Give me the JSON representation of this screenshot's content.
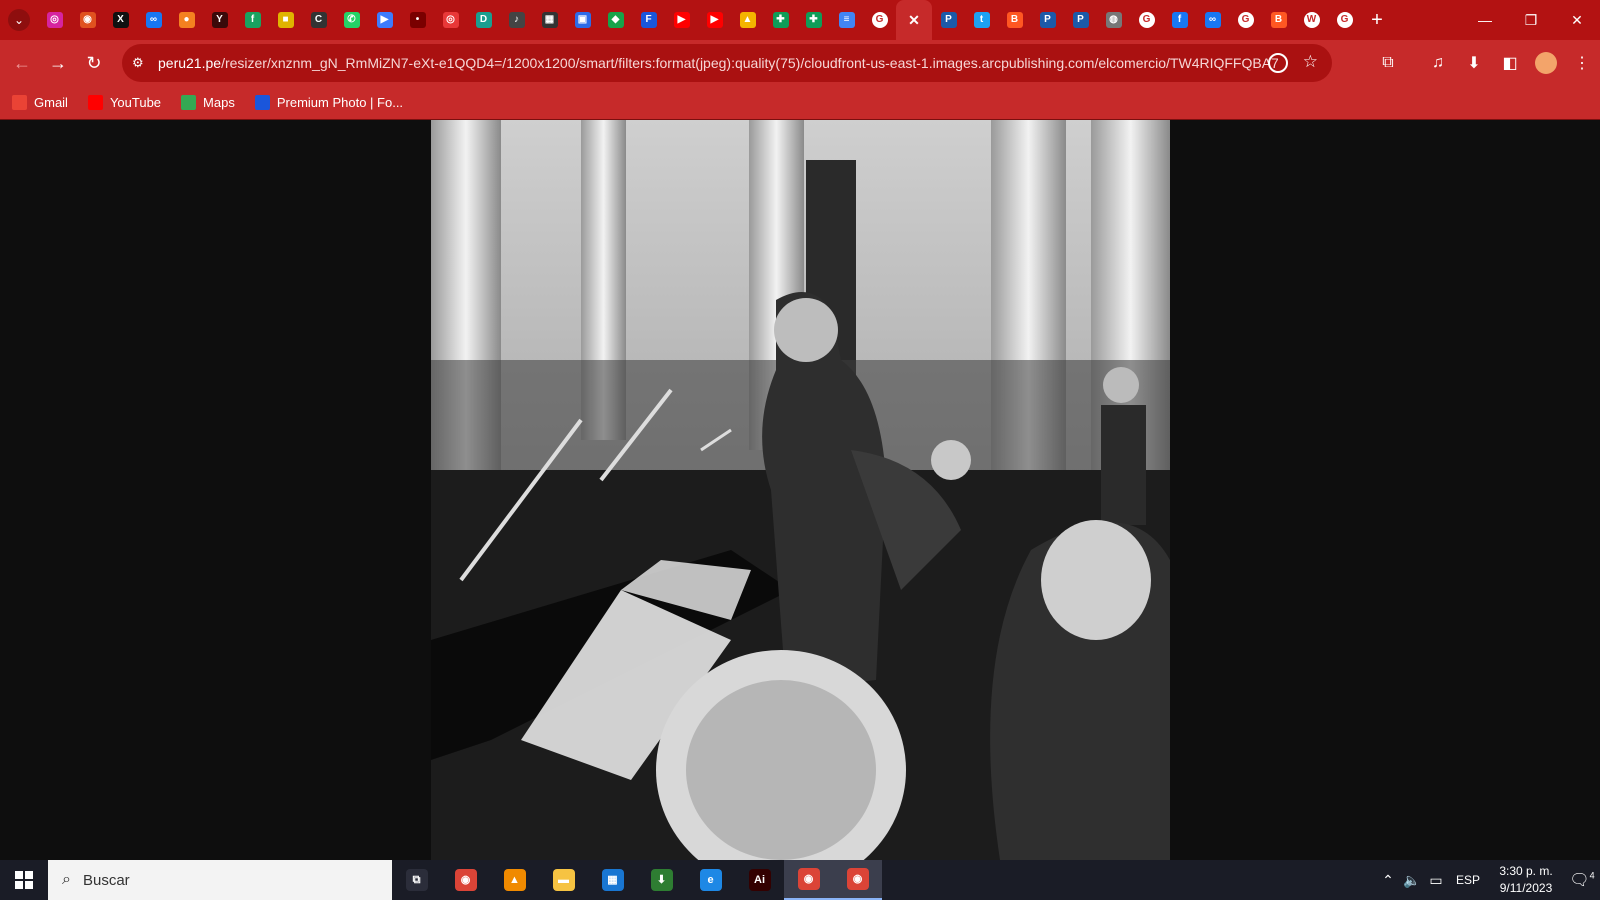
{
  "tabstrip": {
    "tab_search_icon": "chevron-down-icon",
    "favicons": [
      {
        "name": "instagram",
        "color": "#d6249f",
        "glyph": "◎"
      },
      {
        "name": "reddit",
        "color": "#e0521f",
        "glyph": "◉"
      },
      {
        "name": "x",
        "color": "#111111",
        "glyph": "X"
      },
      {
        "name": "meta",
        "color": "#1877f2",
        "glyph": "∞"
      },
      {
        "name": "crunchyroll",
        "color": "#f48120",
        "glyph": "●"
      },
      {
        "name": "yt-dark",
        "color": "#3a0a0a",
        "glyph": "Y"
      },
      {
        "name": "sheets-f",
        "color": "#1aa260",
        "glyph": "f"
      },
      {
        "name": "color-grid",
        "color": "#e0b400",
        "glyph": "■"
      },
      {
        "name": "c-letter",
        "color": "#333333",
        "glyph": "C"
      },
      {
        "name": "whatsapp",
        "color": "#25d366",
        "glyph": "✆"
      },
      {
        "name": "play",
        "color": "#3d7bfd",
        "glyph": "▶"
      },
      {
        "name": "red-dot",
        "color": "#7a0000",
        "glyph": "•"
      },
      {
        "name": "target",
        "color": "#e83838",
        "glyph": "◎"
      },
      {
        "name": "docs-d",
        "color": "#1a9e8f",
        "glyph": "D"
      },
      {
        "name": "audio",
        "color": "#444444",
        "glyph": "♪"
      },
      {
        "name": "film",
        "color": "#333333",
        "glyph": "▦"
      },
      {
        "name": "map-ph",
        "color": "#2d6be8",
        "glyph": "▣"
      },
      {
        "name": "green-square",
        "color": "#17a34a",
        "glyph": "◆"
      },
      {
        "name": "f-blue",
        "color": "#1a56db",
        "glyph": "F"
      },
      {
        "name": "youtube",
        "color": "#ff0000",
        "glyph": "▶"
      },
      {
        "name": "youtube-2",
        "color": "#ff0000",
        "glyph": "▶"
      },
      {
        "name": "drive",
        "color": "#f4b400",
        "glyph": "▲"
      },
      {
        "name": "sheets",
        "color": "#0f9d58",
        "glyph": "✚"
      },
      {
        "name": "sheets-2",
        "color": "#0f9d58",
        "glyph": "✚"
      },
      {
        "name": "forms",
        "color": "#4285f4",
        "glyph": "≡"
      },
      {
        "name": "google",
        "color": "#ffffff",
        "glyph": "G"
      }
    ],
    "active_tab_icon": "close-icon",
    "favicons_right": [
      {
        "name": "p21",
        "color": "#1c5aa8",
        "glyph": "P"
      },
      {
        "name": "twitter",
        "color": "#1da1f2",
        "glyph": "t"
      },
      {
        "name": "blogger",
        "color": "#ff5722",
        "glyph": "B"
      },
      {
        "name": "p21-2",
        "color": "#1c5aa8",
        "glyph": "P"
      },
      {
        "name": "p21-3",
        "color": "#1c5aa8",
        "glyph": "P"
      },
      {
        "name": "globe",
        "color": "#777777",
        "glyph": "◍"
      },
      {
        "name": "google-2",
        "color": "#ffffff",
        "glyph": "G"
      },
      {
        "name": "facebook",
        "color": "#1877f2",
        "glyph": "f"
      },
      {
        "name": "meta-2",
        "color": "#1877f2",
        "glyph": "∞"
      },
      {
        "name": "google-3",
        "color": "#ffffff",
        "glyph": "G"
      },
      {
        "name": "blogger-2",
        "color": "#ff5722",
        "glyph": "B"
      },
      {
        "name": "wikipedia",
        "color": "#ffffff",
        "glyph": "W"
      },
      {
        "name": "google-4",
        "color": "#ffffff",
        "glyph": "G"
      }
    ],
    "new_tab_label": "+",
    "window_controls": {
      "minimize": "—",
      "restore": "❐",
      "close": "✕"
    }
  },
  "toolbar": {
    "url_host": "peru21.pe",
    "url_path": "/resizer/xnznm_gN_RmMiZN7-eXt-e1QQD4=/1200x1200/smart/filters:format(jpeg):quality(75)/cloudfront-us-east-1.images.arcpublishing.com/elcomercio/TW4RIQFFQBA7..."
  },
  "bookmarks": [
    {
      "label": "Gmail",
      "color": "#ea4335"
    },
    {
      "label": "YouTube",
      "color": "#ff0000"
    },
    {
      "label": "Maps",
      "color": "#34a853"
    },
    {
      "label": "Premium Photo | Fo...",
      "color": "#1a56db"
    }
  ],
  "taskbar": {
    "search_placeholder": "Buscar",
    "apps": [
      {
        "name": "task-view",
        "color": "#2b2d3a",
        "glyph": "⧉"
      },
      {
        "name": "chrome",
        "color": "#db4437",
        "glyph": "◉"
      },
      {
        "name": "vlc",
        "color": "#f08a00",
        "glyph": "▲"
      },
      {
        "name": "file-explorer",
        "color": "#f6c342",
        "glyph": "▬"
      },
      {
        "name": "store",
        "color": "#1976d2",
        "glyph": "▦"
      },
      {
        "name": "download-app",
        "color": "#2e7d32",
        "glyph": "⬇"
      },
      {
        "name": "edge-legacy",
        "color": "#1e88e5",
        "glyph": "e"
      },
      {
        "name": "illustrator",
        "color": "#330000",
        "glyph": "Ai"
      },
      {
        "name": "chrome-active",
        "color": "#db4437",
        "glyph": "◉"
      },
      {
        "name": "chrome-alt",
        "color": "#db4437",
        "glyph": "◉"
      }
    ],
    "tray": {
      "language": "ESP",
      "time": "3:30 p. m.",
      "date": "9/11/2023",
      "notifications": "4"
    }
  }
}
